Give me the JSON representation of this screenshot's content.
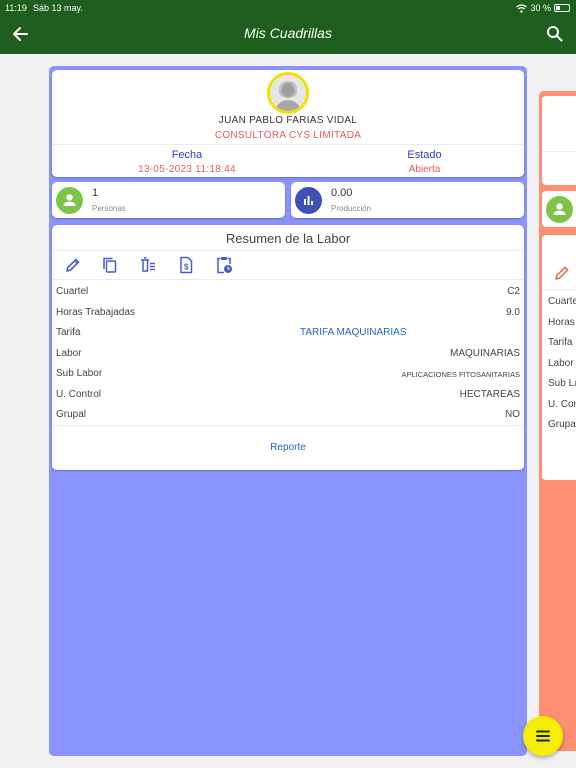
{
  "status_bar": {
    "time": "11:19",
    "date": "Sáb 13 may.",
    "battery": "30 %"
  },
  "appbar": {
    "title": "Mis Cuadrillas",
    "back_icon": "arrow-left-icon",
    "search_icon": "search-icon"
  },
  "card": {
    "worker_name": "JUAN PABLO FARIAS VIDAL",
    "company": "CONSULTORA CYS LIMITADA",
    "fecha_label": "Fecha",
    "fecha_value": "13-05-2023 11:18:44",
    "estado_label": "Estado",
    "estado_value": "Abierta",
    "personas": {
      "value": "1",
      "label": "Personas"
    },
    "produccion": {
      "value": "0.00",
      "label": "Producción"
    },
    "summary": {
      "title": "Resumen de la Labor",
      "tools": [
        "pencil-icon",
        "copy-icon",
        "delete-list-icon",
        "document-dollar-icon",
        "clipboard-clock-icon"
      ],
      "rows": [
        {
          "label": "Cuartel",
          "value": "C2"
        },
        {
          "label": "Horas Trabajadas",
          "value": "9.0"
        },
        {
          "label": "Tarifa",
          "value": "TARIFA MAQUINARIAS"
        },
        {
          "label": "Labor",
          "value": "MAQUINARIAS"
        },
        {
          "label": "Sub Labor",
          "value": "APLICACIONES FITOSANITARIAS"
        },
        {
          "label": "U. Control",
          "value": "HECTAREAS"
        },
        {
          "label": "Grupal",
          "value": "NO"
        }
      ],
      "report_link": "Reporte"
    }
  },
  "peek_card": {
    "rows": [
      "Cuarte",
      "Horas T",
      "Tarifa",
      "Labor",
      "Sub La",
      "U. Con",
      "Grupal"
    ]
  },
  "colors": {
    "appbar": "#1e5e1e",
    "card_blue": "#8a94ff",
    "card_peek": "#ff8f72",
    "fab": "#f6ee00",
    "accent_red": "#e55a5a",
    "accent_blue": "#2b3fbf"
  }
}
